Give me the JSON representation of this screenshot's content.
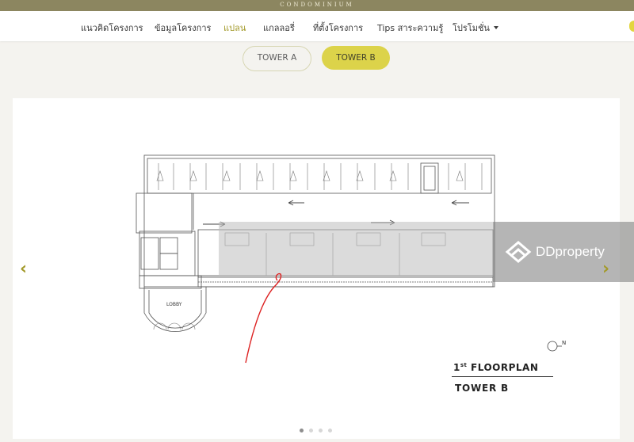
{
  "topbar": {
    "text": "CONDOMINIUM"
  },
  "nav": {
    "items": [
      {
        "label": "แนวคิดโครงการ"
      },
      {
        "label": "ข้อมูลโครงการ"
      },
      {
        "label": "แปลน"
      },
      {
        "label": "แกลลอรี่"
      },
      {
        "label": "ที่ตั้งโครงการ"
      },
      {
        "label": "Tips สาระความรู้"
      },
      {
        "label": "โปรโมชั่น"
      }
    ],
    "active_index": 2
  },
  "tabs": [
    {
      "label": "TOWER A",
      "selected": false
    },
    {
      "label": "TOWER B",
      "selected": true
    }
  ],
  "plan": {
    "lobby_label": "LOBBY",
    "north_label": "N",
    "caption_floor": "1",
    "caption_ordinal": "st",
    "caption_suffix": " FLOORPLAN",
    "caption_tower": "TOWER B"
  },
  "watermark": {
    "text": "DDproperty"
  },
  "carousel": {
    "total_slides": 4,
    "current_slide": 1,
    "prev_icon": "chevron-left-icon",
    "next_icon": "chevron-right-icon"
  },
  "colors": {
    "brand": "#8c8660",
    "accent": "#dcd34a",
    "active_nav": "#a39a2a"
  }
}
